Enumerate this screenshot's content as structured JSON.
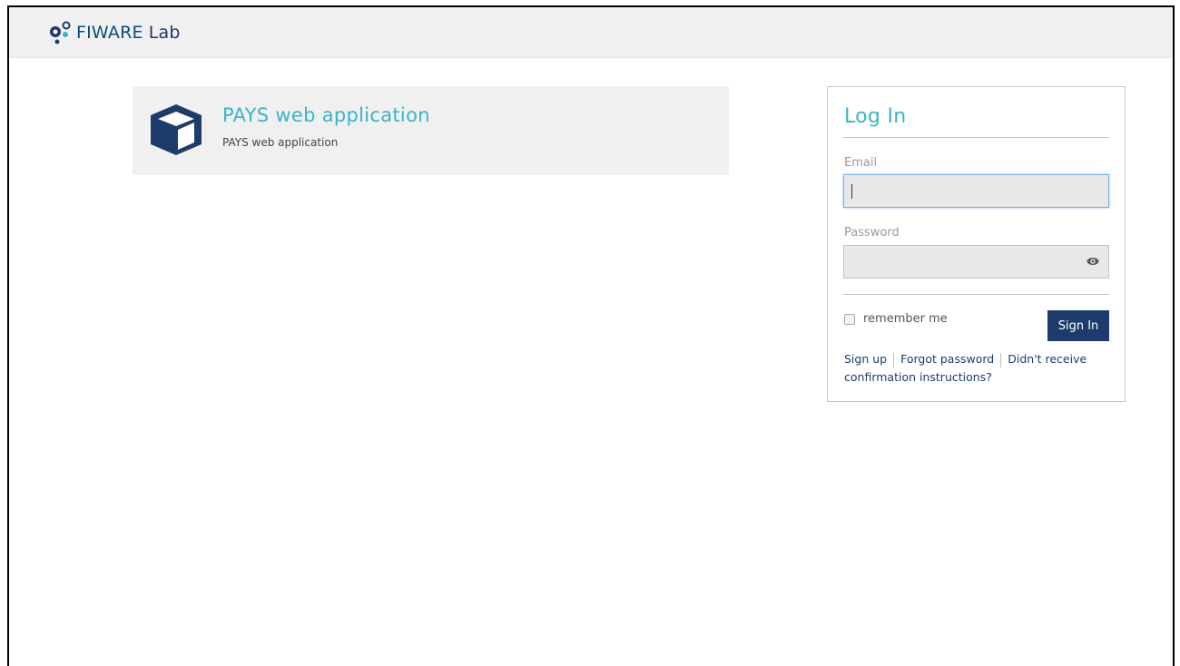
{
  "header": {
    "brand": "FIWARE",
    "brand_suffix": "Lab"
  },
  "app": {
    "title": "PAYS web application",
    "description": "PAYS web application",
    "icon": "cube-icon"
  },
  "login": {
    "title": "Log In",
    "email_label": "Email",
    "email_value": "",
    "password_label": "Password",
    "password_value": "",
    "remember_label": "remember me",
    "remember_checked": false,
    "signin_label": "Sign In",
    "signup_link": "Sign up",
    "forgot_link": "Forgot password",
    "confirm_link": "Didn't receive confirmation instructions?"
  },
  "colors": {
    "accent": "#3bb3c9",
    "primary": "#1d3c6c",
    "topbar": "#f0f0f0"
  }
}
